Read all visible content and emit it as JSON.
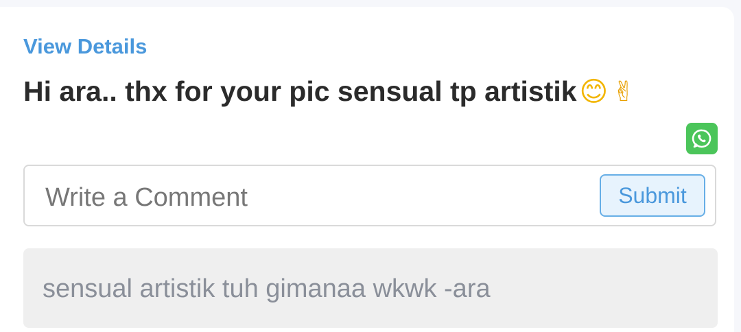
{
  "post": {
    "view_details_label": "View Details",
    "message_text": "Hi ara.. thx for your pic sensual tp artistik",
    "emoji_smile": "😊",
    "emoji_victory": "✌"
  },
  "share": {
    "whatsapp_icon": "whatsapp-icon",
    "whatsapp_color": "#4bc55a"
  },
  "comment_form": {
    "placeholder": "Write a Comment",
    "value": "",
    "submit_label": "Submit"
  },
  "reply": {
    "text": "sensual artistik tuh gimanaa wkwk -ara"
  },
  "colors": {
    "accent": "#4a98dc",
    "text_primary": "#2b2b2b",
    "reply_bg": "#efefef"
  }
}
